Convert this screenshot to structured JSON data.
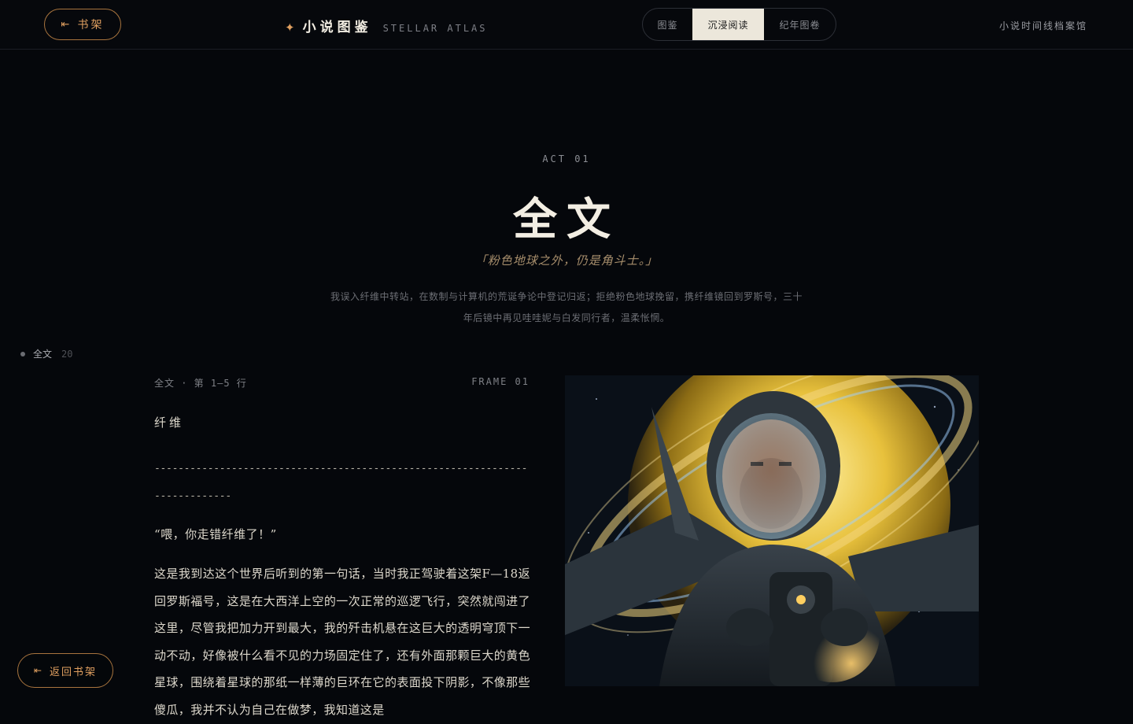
{
  "header": {
    "shelf_icon": "back-to-shelf-icon",
    "shelf_label": "书架",
    "brand_star": "✦",
    "brand_name": "小说图鉴",
    "brand_en": "STELLAR ATLAS",
    "tabs": [
      {
        "label": "图鉴",
        "active": false
      },
      {
        "label": "沉浸阅读",
        "active": true
      },
      {
        "label": "纪年图卷",
        "active": false
      }
    ],
    "archive_title": "小说时间线档案馆"
  },
  "hero": {
    "act": "ACT 01",
    "title": "全文",
    "quote": "「粉色地球之外，仍是角斗士。」",
    "summary": "我误入纤维中转站，在数制与计算机的荒诞争论中登记归返；拒绝粉色地球挽留，携纤维镜回到罗斯号，三十年后镜中再见哇哇妮与白发同行者，温柔怅惘。"
  },
  "side_nav": {
    "label": "全文",
    "count": "20"
  },
  "reader": {
    "meta": "全文 · 第 1–5 行",
    "frame": "FRAME 01",
    "chapter": "纤维",
    "divider": "----------------------------------------------------------------------------",
    "dialog": "“喂，你走错纤维了！”",
    "paragraph": "这是我到达这个世界后听到的第一句话，当时我正驾驶着这架F—18返回罗斯福号，这是在大西洋上空的一次正常的巡逻飞行，突然就闯进了这里，尽管我把加力开到最大，我的歼击机悬在这巨大的透明穹顶下一动不动，好像被什么看不见的力场固定住了，还有外面那颗巨大的黄色星球，围绕着星球的那纸一样薄的巨环在它的表面投下阴影，不像那些傻瓜，我并不认为自己在做梦，我知道这是"
  },
  "illustration": {
    "description_icon": "pilot-in-space-illustration"
  },
  "footer": {
    "return_label": "返回书架"
  },
  "colors": {
    "accent": "#e0a060",
    "background": "#05070b",
    "text": "#e8e3d7"
  }
}
